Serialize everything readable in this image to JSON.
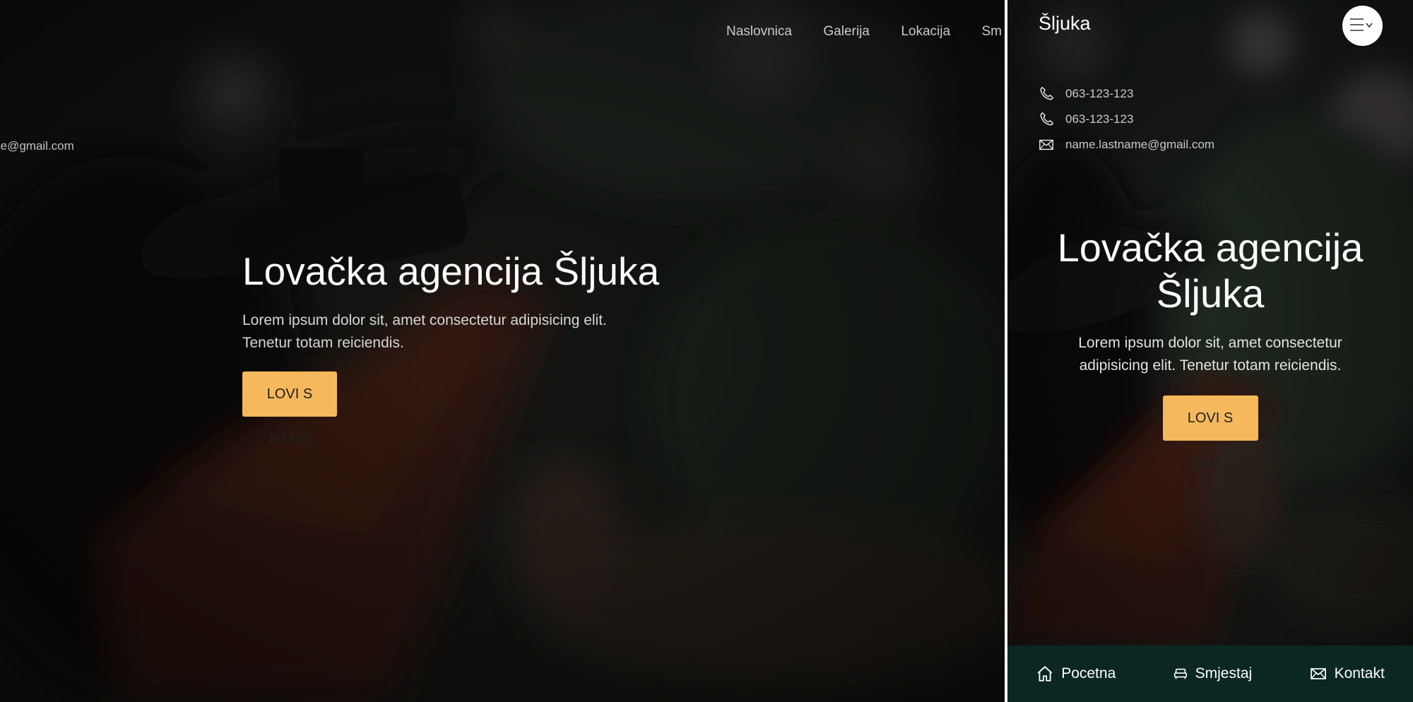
{
  "desktop": {
    "nav": {
      "items": [
        "Naslovnica",
        "Galerija",
        "Lokacija",
        "Sm"
      ]
    },
    "email_partial": "ame@gmail.com",
    "hero": {
      "title": "Lovačka agencija Šljuka",
      "description": "Lorem ipsum dolor sit, amet consectetur adipisicing elit. Tenetur totam reiciendis.",
      "cta_label": "LOVI S NAMA"
    }
  },
  "mobile": {
    "brand": "Šljuka",
    "menu_icon": "menu-icon",
    "contacts": [
      {
        "icon": "phone-icon",
        "text": "063-123-123"
      },
      {
        "icon": "phone-icon",
        "text": "063-123-123"
      },
      {
        "icon": "mail-icon",
        "text": "name.lastname@gmail.com"
      }
    ],
    "hero": {
      "title": "Lovačka agencija Šljuka",
      "description": "Lorem ipsum dolor sit, amet consectetur adipisicing elit. Tenetur totam reiciendis.",
      "cta_label": "LOVI S NAMA"
    },
    "bottom_nav": [
      {
        "icon": "home-icon",
        "label": "Pocetna"
      },
      {
        "icon": "bed-icon",
        "label": "Smjestaj"
      },
      {
        "icon": "mail-icon",
        "label": "Kontakt"
      }
    ]
  },
  "colors": {
    "accent": "#f5b85c",
    "bottom_nav_bg": "#0b2724",
    "divider": "#ffffff"
  }
}
